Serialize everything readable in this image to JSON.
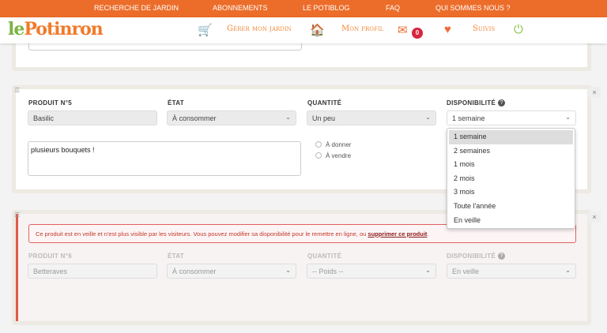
{
  "topnav": [
    "RECHERCHE DE JARDIN",
    "ABONNEMENTS",
    "LE POTIBLOG",
    "FAQ",
    "QUI SOMMES NOUS ?"
  ],
  "logo": {
    "text": "lePotinron"
  },
  "header": {
    "garden": "Gérer mon jardin",
    "profile": "Mon profil",
    "messages_count": "0",
    "follows": "Suivis"
  },
  "product5": {
    "label": "PRODUIT N°5",
    "value": "Basilic",
    "state_label": "ÉTAT",
    "state": "À consommer",
    "qty_label": "QUANTITÉ",
    "qty": "Un peu",
    "avail_label": "DISPONIBILITÉ",
    "avail": "1 semaine",
    "note": "plusieurs bouquets !",
    "radio_give": "À donner",
    "radio_sell": "À vendre"
  },
  "dropdown": [
    "1 semaine",
    "2 semaines",
    "1 mois",
    "2 mois",
    "3 mois",
    "Toute l'année",
    "En veille"
  ],
  "product6": {
    "alert": "Ce produit est en veille et n'est plus visible par les visiteurs. Vous pouvez modifier sa disponibilité pour le remettre en ligne, ou ",
    "alert_link": "supprimer ce produit",
    "alert_end": ".",
    "label": "PRODUIT N°6",
    "value": "Betteraves",
    "state_label": "ÉTAT",
    "state": "À consommer",
    "qty_label": "QUANTITÉ",
    "qty": "-- Poids --",
    "avail_label": "DISPONIBILITÉ",
    "avail": "En veille"
  }
}
